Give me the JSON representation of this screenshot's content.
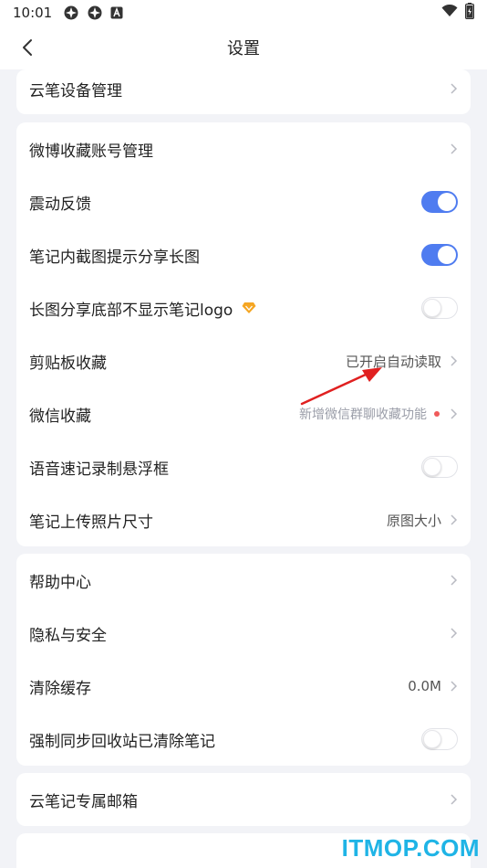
{
  "status_bar": {
    "time": "10:01"
  },
  "header": {
    "title": "设置"
  },
  "sections": [
    {
      "items": [
        {
          "label": "云笔设备管理",
          "type": "chevron"
        }
      ]
    },
    {
      "items": [
        {
          "label": "微博收藏账号管理",
          "type": "chevron"
        },
        {
          "label": "震动反馈",
          "type": "toggle",
          "on": true
        },
        {
          "label": "笔记内截图提示分享长图",
          "type": "toggle",
          "on": true
        },
        {
          "label": "长图分享底部不显示笔记logo",
          "type": "toggle",
          "on": false,
          "badge": "vip-diamond-icon"
        },
        {
          "label": "剪贴板收藏",
          "type": "chevron",
          "value": "已开启自动读取"
        },
        {
          "label": "微信收藏",
          "type": "chevron",
          "value": "新增微信群聊收藏功能",
          "dot": true
        },
        {
          "label": "语音速记录制悬浮框",
          "type": "toggle",
          "on": false
        },
        {
          "label": "笔记上传照片尺寸",
          "type": "chevron",
          "value": "原图大小"
        }
      ]
    },
    {
      "items": [
        {
          "label": "帮助中心",
          "type": "chevron"
        },
        {
          "label": "隐私与安全",
          "type": "chevron"
        },
        {
          "label": "清除缓存",
          "type": "chevron",
          "value": "0.0M"
        },
        {
          "label": "强制同步回收站已清除笔记",
          "type": "toggle",
          "on": false
        }
      ]
    },
    {
      "items": [
        {
          "label": "云笔记专属邮箱",
          "type": "chevron"
        }
      ]
    }
  ],
  "watermark": "ITMOP.COM",
  "colors": {
    "accent": "#4f7cf0",
    "background": "#f2f3f7",
    "annotation_arrow": "#e02020",
    "watermark": "#1fb4e6",
    "vip_badge": "#f5a623"
  }
}
